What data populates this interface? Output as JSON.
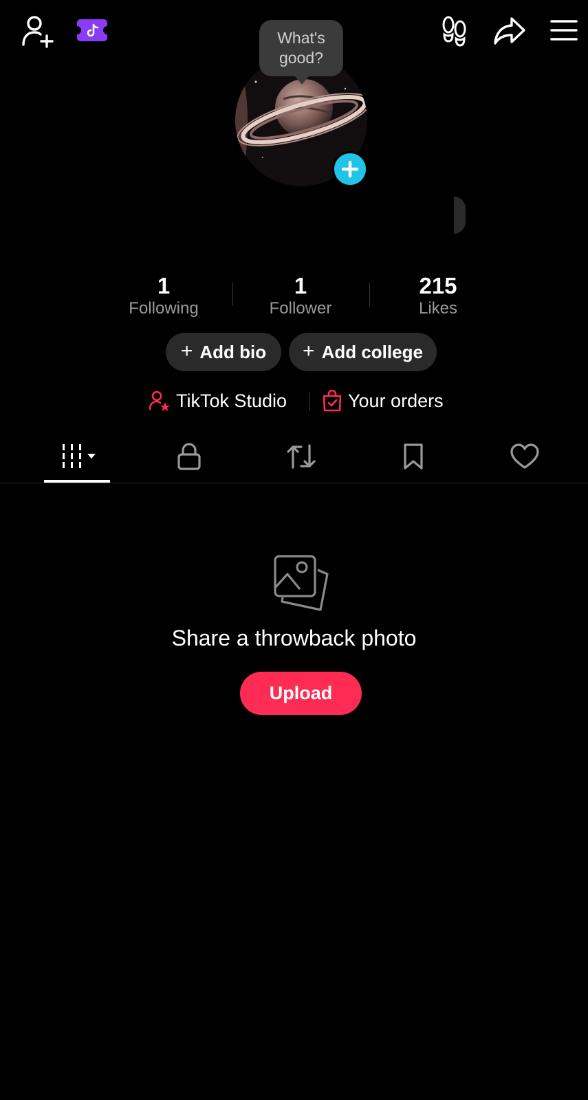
{
  "header": {
    "icons": {
      "add_friend": "person-plus-icon",
      "tiktok_badge": "tiktok-ticket-icon",
      "footprints": "footprints-icon",
      "share": "share-arrow-icon",
      "menu": "hamburger-menu-icon"
    },
    "badge_color": "#8a3cf5"
  },
  "profile": {
    "bubble_line1": "What's",
    "bubble_line2": "good?",
    "add_avatar_color": "#20c4e6"
  },
  "stats": [
    {
      "value": "1",
      "label": "Following"
    },
    {
      "value": "1",
      "label": "Follower"
    },
    {
      "value": "215",
      "label": "Likes"
    }
  ],
  "actions": {
    "add_bio": "Add bio",
    "add_college": "Add college",
    "plus": "+"
  },
  "links": {
    "studio": "TikTok Studio",
    "orders": "Your orders",
    "accent_color": "#fe2c55"
  },
  "tabs": [
    {
      "name": "videos",
      "icon": "grid-bars-icon",
      "active": true
    },
    {
      "name": "private",
      "icon": "lock-icon",
      "active": false
    },
    {
      "name": "reposts",
      "icon": "repost-icon",
      "active": false
    },
    {
      "name": "favorites",
      "icon": "bookmark-icon",
      "active": false
    },
    {
      "name": "liked",
      "icon": "heart-icon",
      "active": false
    }
  ],
  "empty_state": {
    "icon": "photos-icon",
    "title": "Share a throwback photo",
    "button": "Upload",
    "button_color": "#fe2c55"
  }
}
